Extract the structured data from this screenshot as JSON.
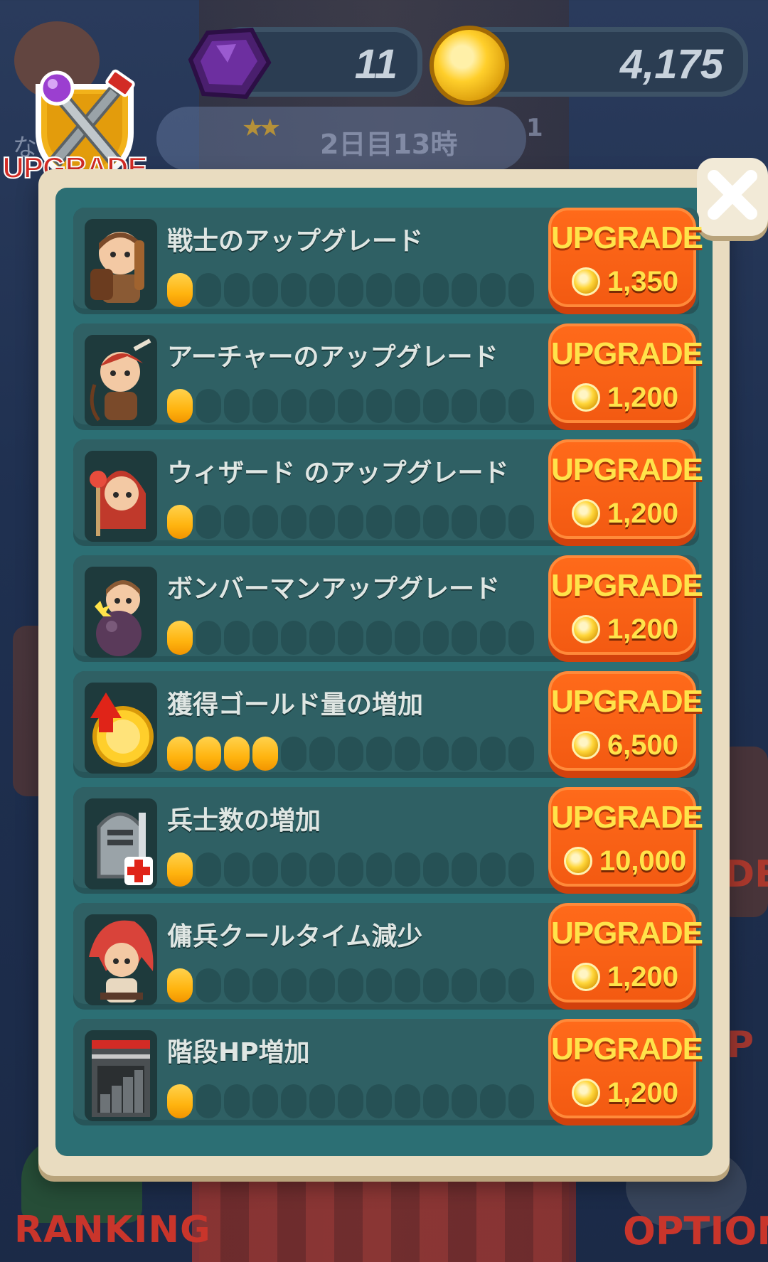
{
  "hud": {
    "gems": "11",
    "gold": "4,175",
    "day_time": "2日目13時",
    "left_char": "な",
    "counter": "1"
  },
  "badge": {
    "label": "UPGRADE"
  },
  "side_labels": {
    "right_partial": "DE",
    "right_partial2": "P"
  },
  "bottom": {
    "ranking": "RANKING",
    "option": "OPTION"
  },
  "upgrades": [
    {
      "title": "戦士のアップグレード",
      "level": 1,
      "max_level": 13,
      "button_label": "UPGRADE",
      "price": "1,350",
      "icon": "warrior-portrait"
    },
    {
      "title": "アーチャーのアップグレード",
      "level": 1,
      "max_level": 13,
      "button_label": "UPGRADE",
      "price": "1,200",
      "icon": "archer-portrait"
    },
    {
      "title": "ウィザード のアップグレード",
      "level": 1,
      "max_level": 13,
      "button_label": "UPGRADE",
      "price": "1,200",
      "icon": "wizard-portrait"
    },
    {
      "title": "ボンバーマンアップグレード",
      "level": 1,
      "max_level": 13,
      "button_label": "UPGRADE",
      "price": "1,200",
      "icon": "bomber-portrait"
    },
    {
      "title": "獲得ゴールド量の増加",
      "level": 4,
      "max_level": 13,
      "button_label": "UPGRADE",
      "price": "6,500",
      "icon": "gold-up-icon"
    },
    {
      "title": "兵士数の増加",
      "level": 1,
      "max_level": 13,
      "button_label": "UPGRADE",
      "price": "10,000",
      "icon": "soldier-plus-icon"
    },
    {
      "title": "傭兵クールタイム減少",
      "level": 1,
      "max_level": 13,
      "button_label": "UPGRADE",
      "price": "1,200",
      "icon": "mercenary-portrait"
    },
    {
      "title": "階段HP増加",
      "level": 1,
      "max_level": 13,
      "button_label": "UPGRADE",
      "price": "1,200",
      "icon": "stairs-hp-icon"
    }
  ],
  "colors": {
    "panel": "#2c6f74",
    "button": "#f35a12",
    "button_text": "#ffe34a",
    "pip_on": "#ffb40f",
    "frame": "#e9dcc0"
  }
}
